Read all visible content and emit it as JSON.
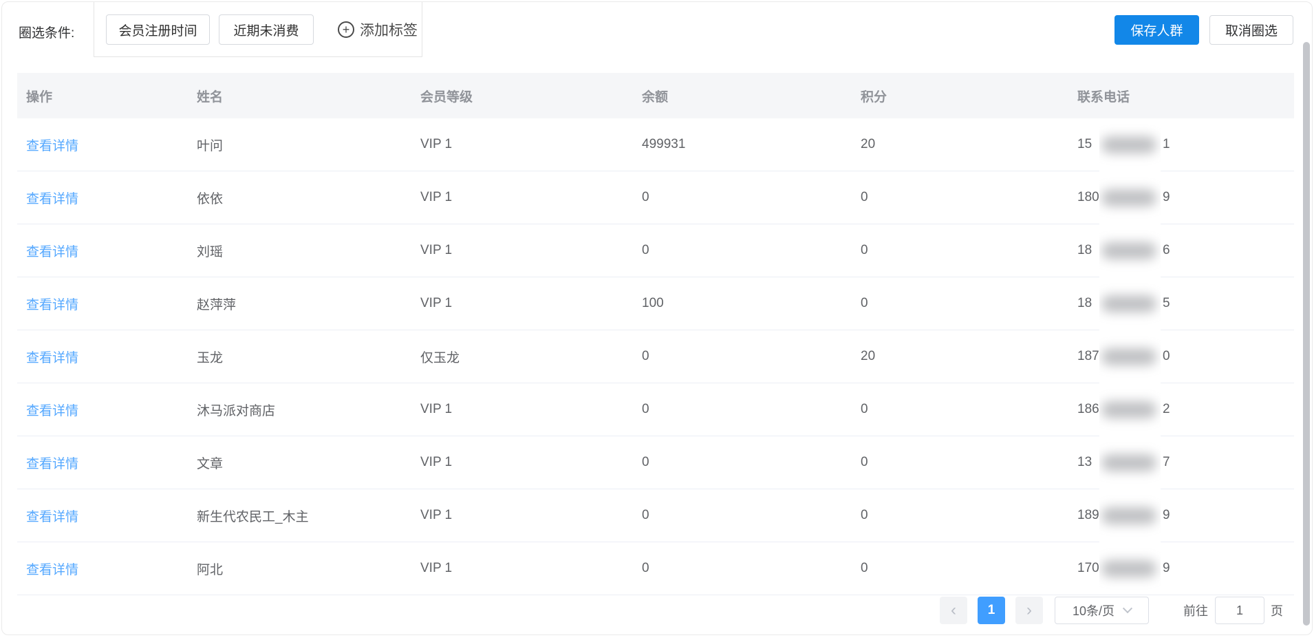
{
  "colors": {
    "primary": "#1287e8",
    "link": "#55a8ff",
    "page_active": "#409eff"
  },
  "filters": {
    "label": "圈选条件:",
    "buttons": [
      "会员注册时间",
      "近期未消费"
    ],
    "add_tag_label": "添加标签"
  },
  "actions": {
    "save": "保存人群",
    "cancel": "取消圈选"
  },
  "table": {
    "columns": [
      "操作",
      "姓名",
      "会员等级",
      "余额",
      "积分",
      "联系电话"
    ],
    "action_label": "查看详情",
    "rows": [
      {
        "name": "叶问",
        "level": "VIP 1",
        "balance": "499931",
        "points": "20",
        "phone_prefix": "15",
        "phone_suffix": "1"
      },
      {
        "name": "依依",
        "level": "VIP 1",
        "balance": "0",
        "points": "0",
        "phone_prefix": "180",
        "phone_suffix": "9"
      },
      {
        "name": "刘瑶",
        "level": "VIP 1",
        "balance": "0",
        "points": "0",
        "phone_prefix": "18",
        "phone_suffix": "6"
      },
      {
        "name": "赵萍萍",
        "level": "VIP 1",
        "balance": "100",
        "points": "0",
        "phone_prefix": "18",
        "phone_suffix": "5"
      },
      {
        "name": "玉龙",
        "level": "仅玉龙",
        "balance": "0",
        "points": "20",
        "phone_prefix": "187",
        "phone_suffix": "0"
      },
      {
        "name": "沐马派对商店",
        "level": "VIP 1",
        "balance": "0",
        "points": "0",
        "phone_prefix": "186",
        "phone_suffix": "2"
      },
      {
        "name": "文章",
        "level": "VIP 1",
        "balance": "0",
        "points": "0",
        "phone_prefix": "13",
        "phone_suffix": "7"
      },
      {
        "name": "新生代农民工_木主",
        "level": "VIP 1",
        "balance": "0",
        "points": "0",
        "phone_prefix": "189",
        "phone_suffix": "9"
      },
      {
        "name": "阿北",
        "level": "VIP 1",
        "balance": "0",
        "points": "0",
        "phone_prefix": "170",
        "phone_suffix": "9"
      }
    ]
  },
  "pagination": {
    "prev_icon": "‹",
    "next_icon": "›",
    "pages": [
      "1"
    ],
    "page_size": "10条/页",
    "goto_label": "前往",
    "goto_value": "1",
    "page_unit": "页"
  },
  "icons": {
    "plus": "+"
  }
}
